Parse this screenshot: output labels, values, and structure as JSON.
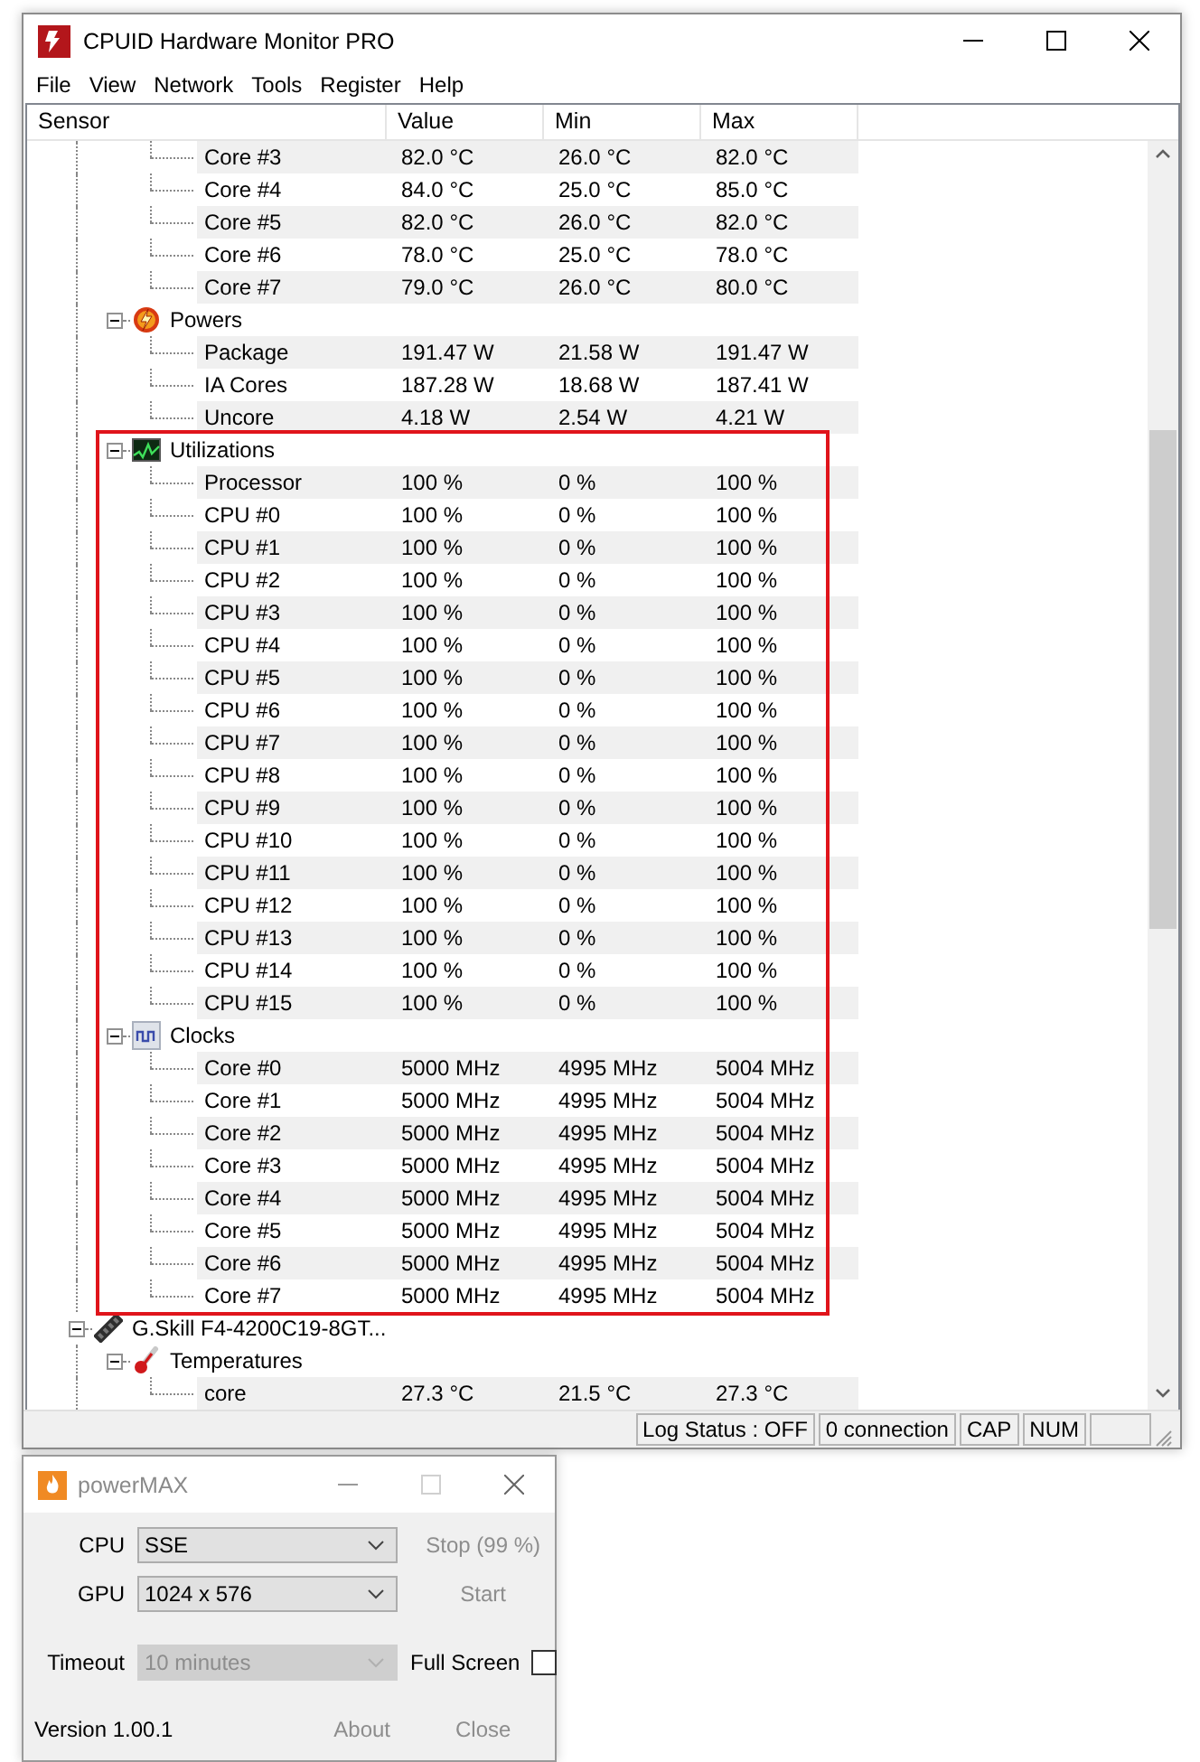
{
  "window": {
    "title": "CPUID Hardware Monitor PRO"
  },
  "menu": [
    "File",
    "View",
    "Network",
    "Tools",
    "Register",
    "Help"
  ],
  "columns": [
    "Sensor",
    "Value",
    "Min",
    "Max"
  ],
  "tree": [
    {
      "children": [
        {
          "children": [
            {
              "label": "Core #3",
              "values": [
                "82.0 °C",
                "26.0 °C",
                "82.0 °C"
              ]
            },
            {
              "label": "Core #4",
              "values": [
                "84.0 °C",
                "25.0 °C",
                "85.0 °C"
              ]
            },
            {
              "label": "Core #5",
              "values": [
                "82.0 °C",
                "26.0 °C",
                "82.0 °C"
              ]
            },
            {
              "label": "Core #6",
              "values": [
                "78.0 °C",
                "25.0 °C",
                "78.0 °C"
              ]
            },
            {
              "label": "Core #7",
              "values": [
                "79.0 °C",
                "26.0 °C",
                "80.0 °C"
              ]
            }
          ]
        },
        {
          "label": "Powers",
          "kind": "power",
          "expanded": true,
          "highlighted": false,
          "children": [
            {
              "label": "Package",
              "values": [
                "191.47 W",
                "21.58 W",
                "191.47 W"
              ]
            },
            {
              "label": "IA Cores",
              "values": [
                "187.28 W",
                "18.68 W",
                "187.41 W"
              ]
            },
            {
              "label": "Uncore",
              "values": [
                "4.18 W",
                "2.54 W",
                "4.21 W"
              ]
            }
          ]
        },
        {
          "label": "Utilizations",
          "kind": "utilization",
          "expanded": true,
          "highlighted": true,
          "children": [
            {
              "label": "Processor",
              "values": [
                "100 %",
                "0 %",
                "100 %"
              ]
            },
            {
              "label": "CPU #0",
              "values": [
                "100 %",
                "0 %",
                "100 %"
              ]
            },
            {
              "label": "CPU #1",
              "values": [
                "100 %",
                "0 %",
                "100 %"
              ]
            },
            {
              "label": "CPU #2",
              "values": [
                "100 %",
                "0 %",
                "100 %"
              ]
            },
            {
              "label": "CPU #3",
              "values": [
                "100 %",
                "0 %",
                "100 %"
              ]
            },
            {
              "label": "CPU #4",
              "values": [
                "100 %",
                "0 %",
                "100 %"
              ]
            },
            {
              "label": "CPU #5",
              "values": [
                "100 %",
                "0 %",
                "100 %"
              ]
            },
            {
              "label": "CPU #6",
              "values": [
                "100 %",
                "0 %",
                "100 %"
              ]
            },
            {
              "label": "CPU #7",
              "values": [
                "100 %",
                "0 %",
                "100 %"
              ]
            },
            {
              "label": "CPU #8",
              "values": [
                "100 %",
                "0 %",
                "100 %"
              ]
            },
            {
              "label": "CPU #9",
              "values": [
                "100 %",
                "0 %",
                "100 %"
              ]
            },
            {
              "label": "CPU #10",
              "values": [
                "100 %",
                "0 %",
                "100 %"
              ]
            },
            {
              "label": "CPU #11",
              "values": [
                "100 %",
                "0 %",
                "100 %"
              ]
            },
            {
              "label": "CPU #12",
              "values": [
                "100 %",
                "0 %",
                "100 %"
              ]
            },
            {
              "label": "CPU #13",
              "values": [
                "100 %",
                "0 %",
                "100 %"
              ]
            },
            {
              "label": "CPU #14",
              "values": [
                "100 %",
                "0 %",
                "100 %"
              ]
            },
            {
              "label": "CPU #15",
              "values": [
                "100 %",
                "0 %",
                "100 %"
              ]
            }
          ]
        },
        {
          "label": "Clocks",
          "kind": "clock",
          "expanded": true,
          "highlighted": true,
          "children": [
            {
              "label": "Core #0",
              "values": [
                "5000 MHz",
                "4995 MHz",
                "5004 MHz"
              ]
            },
            {
              "label": "Core #1",
              "values": [
                "5000 MHz",
                "4995 MHz",
                "5004 MHz"
              ]
            },
            {
              "label": "Core #2",
              "values": [
                "5000 MHz",
                "4995 MHz",
                "5004 MHz"
              ]
            },
            {
              "label": "Core #3",
              "values": [
                "5000 MHz",
                "4995 MHz",
                "5004 MHz"
              ]
            },
            {
              "label": "Core #4",
              "values": [
                "5000 MHz",
                "4995 MHz",
                "5004 MHz"
              ]
            },
            {
              "label": "Core #5",
              "values": [
                "5000 MHz",
                "4995 MHz",
                "5004 MHz"
              ]
            },
            {
              "label": "Core #6",
              "values": [
                "5000 MHz",
                "4995 MHz",
                "5004 MHz"
              ]
            },
            {
              "label": "Core #7",
              "values": [
                "5000 MHz",
                "4995 MHz",
                "5004 MHz"
              ]
            }
          ]
        }
      ]
    },
    {
      "label": "G.Skill F4-4200C19-8GT...",
      "kind": "memory",
      "expanded": true,
      "highlighted": false,
      "children": [
        {
          "label": "Temperatures",
          "kind": "temperature",
          "expanded": true,
          "highlighted": false,
          "children": [
            {
              "label": "core",
              "values": [
                "27.3 °C",
                "21.5 °C",
                "27.3 °C"
              ]
            }
          ]
        }
      ]
    }
  ],
  "status_bar": [
    "Log Status : OFF",
    "0 connection",
    "CAP",
    "NUM"
  ],
  "powermax": {
    "title": "powerMAX",
    "fields": [
      {
        "label": "CPU",
        "value": "SSE",
        "disabled": false
      },
      {
        "label": "GPU",
        "value": "1024 x 576",
        "disabled": false
      },
      {
        "label": "Timeout",
        "value": "10 minutes",
        "disabled": true
      }
    ],
    "buttons": [
      "Stop (99 %)",
      "Start"
    ],
    "full_screen": {
      "label": "Full Screen",
      "checked": false
    },
    "version": "Version 1.00.1",
    "footer_buttons": [
      "About",
      "Close"
    ]
  }
}
